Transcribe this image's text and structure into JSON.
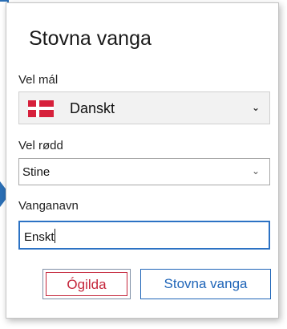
{
  "dialog": {
    "title": "Stovna vanga",
    "language": {
      "label": "Vel mál",
      "selected": "Danskt",
      "flag_icon": "denmark-flag-icon"
    },
    "voice": {
      "label": "Vel rødd",
      "selected": "Stine"
    },
    "name": {
      "label": "Vanganavn",
      "value": "Enskt"
    },
    "buttons": {
      "cancel": "Ógilda",
      "save": "Stovna vanga"
    }
  },
  "colors": {
    "accent": "#2c72c4",
    "cancel": "#c4253a",
    "flag_red": "#d6203b"
  }
}
